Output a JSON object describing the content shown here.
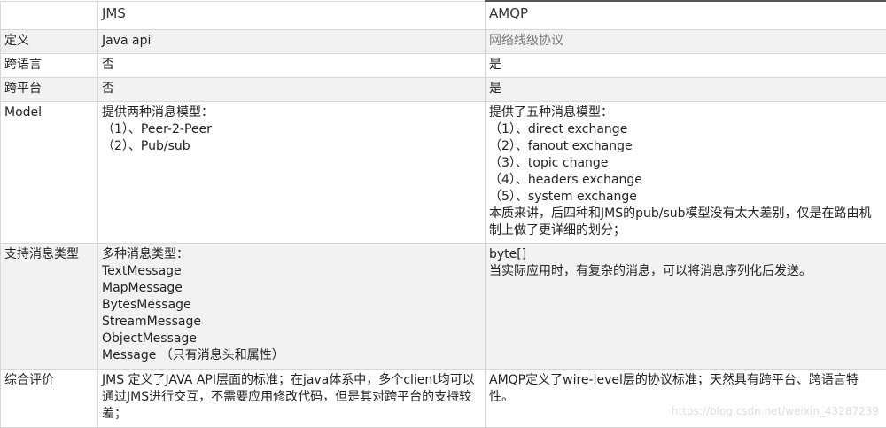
{
  "headers": [
    "",
    "JMS",
    "AMQP"
  ],
  "rows": [
    {
      "label": "定义",
      "jms": [
        "Java api"
      ],
      "amqp": [
        "网络线级协议"
      ]
    },
    {
      "label": "跨语言",
      "jms": [
        "否"
      ],
      "amqp": [
        "是"
      ]
    },
    {
      "label": "跨平台",
      "jms": [
        "否"
      ],
      "amqp": [
        "是"
      ]
    },
    {
      "label": "Model",
      "jms": [
        "提供两种消息模型：",
        "（1）、Peer-2-Peer",
        "（2）、Pub/sub"
      ],
      "amqp": [
        "提供了五种消息模型：",
        "（1）、direct exchange",
        "（2）、fanout exchange",
        "（3）、topic change",
        "（4）、headers exchange",
        "（5）、system exchange",
        "本质来讲，后四种和JMS的pub/sub模型没有太大差别，仅是在路由机制上做了更详细的划分；"
      ]
    },
    {
      "label": "支持消息类型",
      "jms": [
        "多种消息类型：",
        "TextMessage",
        "MapMessage",
        "BytesMessage",
        "StreamMessage",
        "ObjectMessage",
        "Message （只有消息头和属性）"
      ],
      "amqp": [
        "byte[]",
        "当实际应用时，有复杂的消息，可以将消息序列化后发送。"
      ]
    },
    {
      "label": "综合评价",
      "jms": [
        "JMS 定义了JAVA API层面的标准；在java体系中，多个client均可以通过JMS进行交互，不需要应用修改代码，但是其对跨平台的支持较差；"
      ],
      "amqp": [
        "AMQP定义了wire-level层的协议标准；天然具有跨平台、跨语言特性。"
      ]
    }
  ],
  "watermark": "https://blog.csdn.net/weixin_43287239"
}
